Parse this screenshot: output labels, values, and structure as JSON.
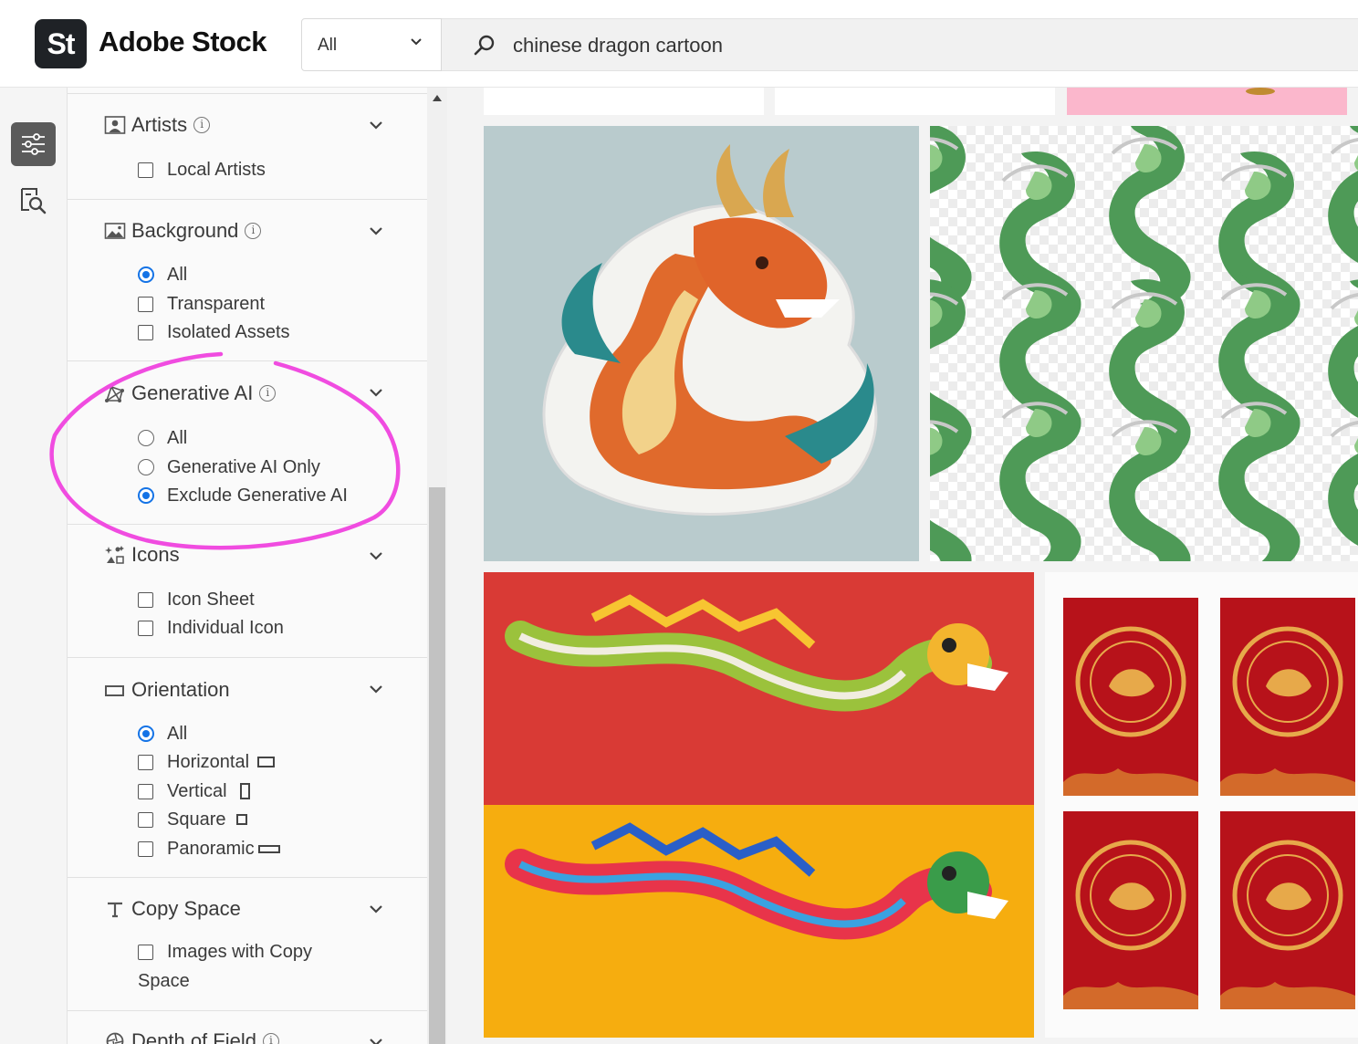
{
  "header": {
    "logo_text": "St",
    "brand": "Adobe Stock",
    "type_select": "All",
    "search_query": "chinese dragon cartoon"
  },
  "filters": {
    "artists": {
      "title": "Artists",
      "options": [
        "Local Artists"
      ]
    },
    "background": {
      "title": "Background",
      "options": [
        "All",
        "Transparent",
        "Isolated Assets"
      ],
      "selected": "All"
    },
    "generative_ai": {
      "title": "Generative AI",
      "options": [
        "All",
        "Generative AI Only",
        "Exclude Generative AI"
      ],
      "selected": "Exclude Generative AI"
    },
    "icons": {
      "title": "Icons",
      "options": [
        "Icon Sheet",
        "Individual Icon"
      ]
    },
    "orientation": {
      "title": "Orientation",
      "options": [
        "All",
        "Horizontal",
        "Vertical",
        "Square",
        "Panoramic"
      ],
      "selected": "All"
    },
    "copy_space": {
      "title": "Copy Space",
      "option_line1": "Images with Copy",
      "option_line2": "Space"
    },
    "depth_of_field": {
      "title": "Depth of Field"
    }
  },
  "colors": {
    "accent": "#1473e6",
    "annotation": "#f04ce0",
    "dark_logo": "#1f2226"
  }
}
